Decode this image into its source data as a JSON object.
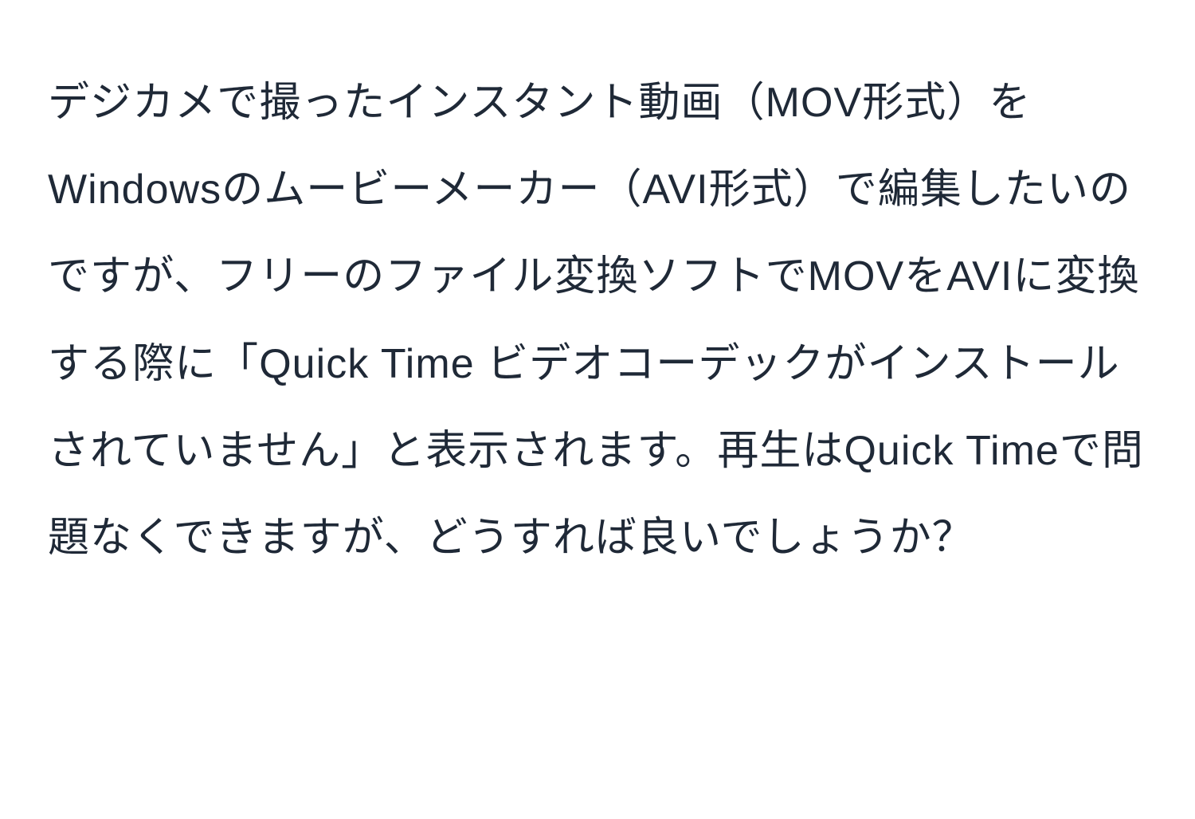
{
  "document": {
    "text": "デジカメで撮ったインスタント動画（MOV形式）をWindowsのムービーメーカー（AVI形式）で編集したいのですが、フリーのファイル変換ソフトでMOVをAVIに変換する際に「Quick Time ビデオコーデックがインストールされていません」と表示されます。再生はQuick Timeで問題なくできますが、どうすれば良いでしょうか？"
  }
}
